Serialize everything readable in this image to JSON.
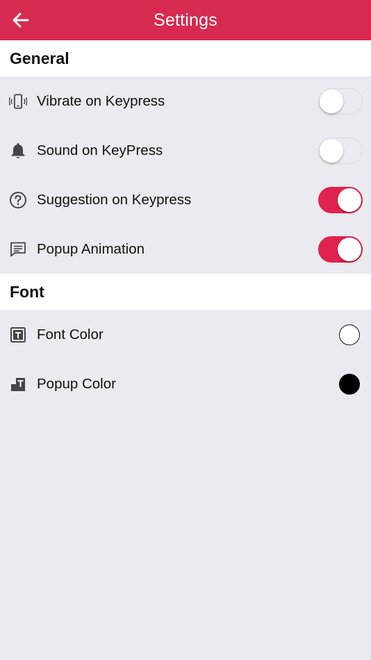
{
  "appbar": {
    "title": "Settings",
    "back_icon": "arrow-left-icon",
    "bg_color": "#d72a50"
  },
  "sections": {
    "general": {
      "title": "General",
      "items": [
        {
          "label": "Vibrate on Keypress",
          "icon": "vibrate-phone-icon",
          "enabled": false
        },
        {
          "label": "Sound on KeyPress",
          "icon": "bell-icon",
          "enabled": false
        },
        {
          "label": "Suggestion on Keypress",
          "icon": "question-circle-icon",
          "enabled": true
        },
        {
          "label": "Popup Animation",
          "icon": "message-lines-icon",
          "enabled": true
        }
      ]
    },
    "font": {
      "title": "Font",
      "items": [
        {
          "label": "Font Color",
          "icon": "text-box-icon",
          "color": "#ffffff"
        },
        {
          "label": "Popup Color",
          "icon": "popup-text-icon",
          "color": "#000000"
        }
      ]
    }
  },
  "colors": {
    "accent": "#e0234e",
    "background": "#ebeaf0"
  }
}
